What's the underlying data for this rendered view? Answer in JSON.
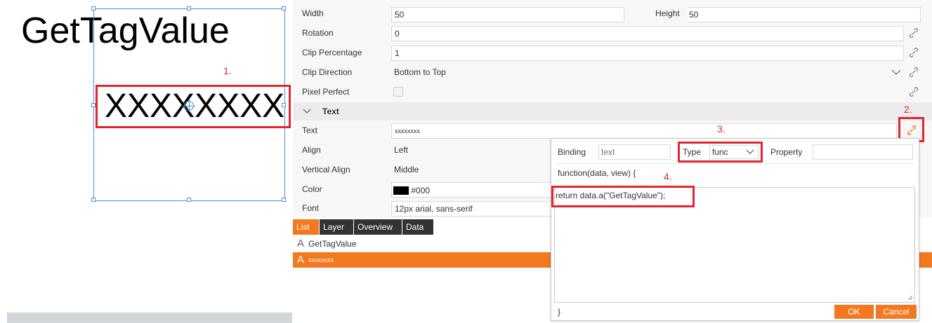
{
  "canvas": {
    "title_text": "GetTagValue",
    "value_text": "XXXXXXXX",
    "annotation_1": "1."
  },
  "properties": {
    "width_label": "Width",
    "width_value": "50",
    "height_label": "Height",
    "height_value": "50",
    "rotation_label": "Rotation",
    "rotation_value": "0",
    "clip_percentage_label": "Clip Percentage",
    "clip_percentage_value": "1",
    "clip_direction_label": "Clip Direction",
    "clip_direction_value": "Bottom to Top",
    "pixel_perfect_label": "Pixel Perfect",
    "section_text_label": "Text",
    "text_label": "Text",
    "text_value": "xxxxxxxx",
    "align_label": "Align",
    "align_value": "Left",
    "vertical_align_label": "Vertical Align",
    "vertical_align_value": "Middle",
    "color_label": "Color",
    "color_value": "#000",
    "font_label": "Font",
    "font_value": "12px arial, sans-serif",
    "annotation_2": "2."
  },
  "tabs": [
    {
      "label": "List"
    },
    {
      "label": "Layer"
    },
    {
      "label": "Overview"
    },
    {
      "label": "Data"
    }
  ],
  "list": {
    "items": [
      {
        "label": "GetTagValue"
      },
      {
        "label": "xxxxxxxx"
      }
    ]
  },
  "binding": {
    "binding_label": "Binding",
    "binding_placeholder": "text",
    "type_label": "Type",
    "type_value": "func",
    "property_label": "Property",
    "func_header": "function(data, view) {",
    "code": "return data.a(\"GetTagValue\");",
    "func_footer": "}",
    "ok_label": "OK",
    "cancel_label": "Cancel",
    "annotation_3": "3.",
    "annotation_4": "4."
  },
  "colors": {
    "accent": "#f37920",
    "highlight": "#e3252d",
    "selection": "#4a90e2"
  }
}
